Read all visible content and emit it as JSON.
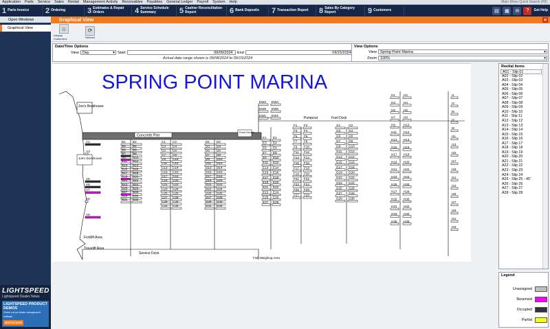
{
  "menu": [
    "Application",
    "Parts",
    "Service",
    "Sales",
    "Rental",
    "Management Activity",
    "Receivables",
    "Payables",
    "General Ledger",
    "Payroll",
    "System",
    "Help"
  ],
  "quick_search": "Main Menu Quick Search (F8)",
  "steps": [
    {
      "num": "1",
      "label": "Parts Invoice"
    },
    {
      "num": "2",
      "label": "Ordering"
    },
    {
      "num": "3",
      "label": "Estimates & Repair Orders"
    },
    {
      "num": "4",
      "label": "Service Schedule Summary"
    },
    {
      "num": "5",
      "label": "Cashier Reconciliation Report"
    },
    {
      "num": "6",
      "label": "Bank Deposits"
    },
    {
      "num": "7",
      "label": "Transaction Report"
    },
    {
      "num": "8",
      "label": "Sales By Category Report"
    },
    {
      "num": "9",
      "label": "Customers"
    }
  ],
  "get_help": "Get Help",
  "sidebar": {
    "header": "Open Windows",
    "items": [
      "Graphical View"
    ]
  },
  "promo": {
    "brand": "LIGHTSPEED",
    "sub": "Lightspeed Dealer News",
    "ad_title": "LIGHTSPEED PRODUCT DEMOS",
    "ad_sub": "Check out our dealer management software",
    "ad_btn": "WATCH NOW"
  },
  "window": {
    "title": "Graphical View"
  },
  "toolbar": [
    {
      "label": "Display Customers",
      "icon": "people-icon"
    },
    {
      "label": "Refresh",
      "icon": "refresh-icon"
    }
  ],
  "datetime": {
    "title": "Date/Time Options",
    "view_label": "View",
    "view_value": "Day",
    "start_label": "Start",
    "start_value": "09/09/2024",
    "end_label": "End",
    "end_value": "09/15/2024",
    "note": "Actual date range shown is 09/08/2024 to 09/15/2024"
  },
  "view_options": {
    "title": "View Options",
    "view_label": "View",
    "view_value": "Spring Point Marina",
    "zoom_label": "Zoom",
    "zoom_value": "100%"
  },
  "map": {
    "title": "SPRING POINT MARINA",
    "labels": {
      "boathouse": "Joe's Boathouse",
      "concrete_pier": "Concrete Pier",
      "dock_house_top": "Dock House",
      "dockhouse_left": "Joe's Dockhouse",
      "forklift": "Forklift Area",
      "travelift": "Travelift Area",
      "service_dock": "Service Dock",
      "fuel_dock": "Fuel Dock",
      "pumpout": "Pumpout",
      "weighing": "Fish Weighing Area"
    },
    "colors": {
      "unassigned": "#c0c0c0",
      "reserved": "#ff00ff",
      "occupied": "#333333",
      "partial": "#ffff00"
    }
  },
  "reel_table": {
    "title": "Reeltal Items",
    "items": [
      "A01 - Slip 01",
      "A02 - Slip 02",
      "A03 - Slip 03",
      "A04 - Slip 04",
      "A05 - Slip 05",
      "A06 - Slip 06",
      "A07 - Slip 07",
      "A08 - Slip 08",
      "A09 - Slip 09",
      "A10 - Slip 10",
      "A11 - Slip 11",
      "A12 - Slip 12",
      "A13 - Slip 13",
      "A14 - Slip 14",
      "A15 - Slip 15",
      "A16 - Slip 16",
      "A17 - Slip 17",
      "A18 - Slip 18",
      "A19 - Slip 19",
      "A20 - Slip 20",
      "A21 - Slip 21",
      "A22 - Slip 22",
      "A23 - Slip 23",
      "A24 - Slip 24",
      "A25 - Slip 25 - 45'",
      "A26 - Slip 26",
      "A27 - Slip 27",
      "A28 - Slip 28"
    ]
  },
  "legend": {
    "title": "Legend",
    "items": [
      {
        "label": "Unassigned",
        "color": "#c0c0c0"
      },
      {
        "label": "Reserved",
        "color": "#ff00ff"
      },
      {
        "label": "Occupied",
        "color": "#333333"
      },
      {
        "label": "Partial",
        "color": "#ffff00"
      }
    ]
  }
}
